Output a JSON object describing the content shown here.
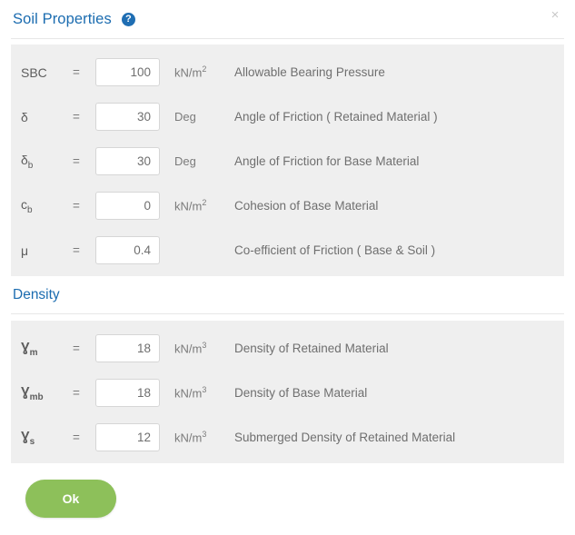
{
  "header": {
    "title": "Soil Properties",
    "help_icon_label": "?",
    "close_icon_label": "×"
  },
  "soil_section": {
    "rows": [
      {
        "symbol": "SBC",
        "subscript": "",
        "equals": "=",
        "value": "100",
        "unit_base": "kN/m",
        "unit_exp": "2",
        "description": "Allowable Bearing Pressure"
      },
      {
        "symbol": "δ",
        "subscript": "",
        "equals": "=",
        "value": "30",
        "unit_base": "Deg",
        "unit_exp": "",
        "description": "Angle of Friction ( Retained Material )"
      },
      {
        "symbol": "δ",
        "subscript": "b",
        "equals": "=",
        "value": "30",
        "unit_base": "Deg",
        "unit_exp": "",
        "description": "Angle of Friction for Base Material"
      },
      {
        "symbol": "c",
        "subscript": "b",
        "equals": "=",
        "value": "0",
        "unit_base": "kN/m",
        "unit_exp": "2",
        "description": "Cohesion of Base Material"
      },
      {
        "symbol": "μ",
        "subscript": "",
        "equals": "=",
        "value": "0.4",
        "unit_base": "",
        "unit_exp": "",
        "description": "Co-efficient of Friction ( Base & Soil )"
      }
    ]
  },
  "density_section": {
    "heading": "Density",
    "rows": [
      {
        "symbol": "Ɣ",
        "subscript": "m",
        "equals": "=",
        "value": "18",
        "unit_base": "kN/m",
        "unit_exp": "3",
        "description": "Density of Retained Material"
      },
      {
        "symbol": "Ɣ",
        "subscript": "mb",
        "equals": "=",
        "value": "18",
        "unit_base": "kN/m",
        "unit_exp": "3",
        "description": "Density of Base Material"
      },
      {
        "symbol": "Ɣ",
        "subscript": "s",
        "equals": "=",
        "value": "12",
        "unit_base": "kN/m",
        "unit_exp": "3",
        "description": "Submerged Density of Retained Material"
      }
    ]
  },
  "footer": {
    "ok_label": "Ok"
  },
  "colors": {
    "title_blue": "#1b6cb0",
    "panel_gray": "#efefef",
    "ok_green": "#8dc05a",
    "text_gray": "#6f6f6f"
  }
}
